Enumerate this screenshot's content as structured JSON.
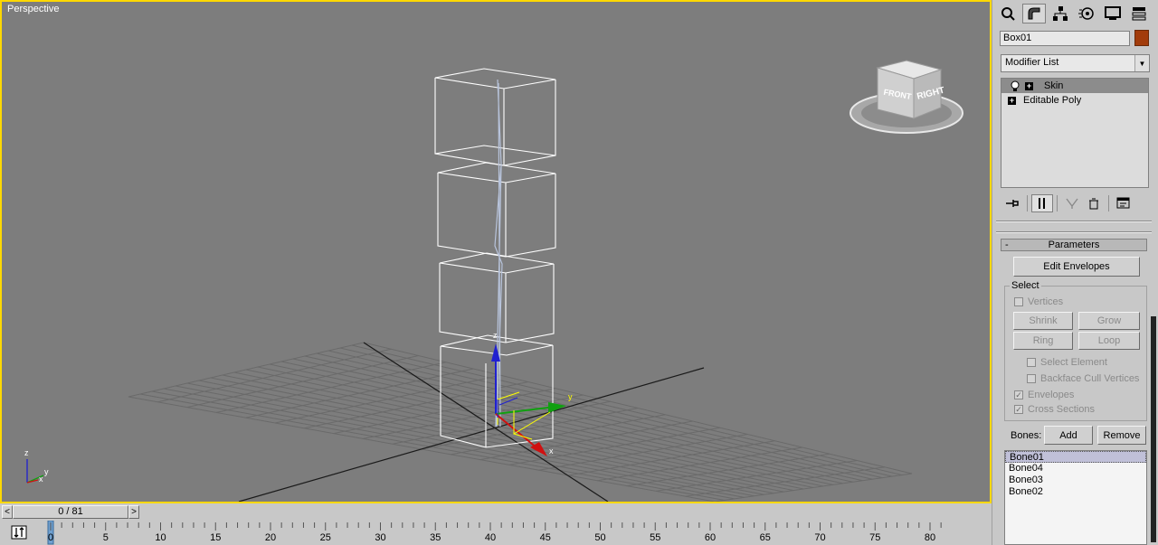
{
  "viewport": {
    "label": "Perspective",
    "viewcube": {
      "front": "FRONT",
      "right": "RIGHT"
    },
    "gizmo_axes": {
      "x": "x",
      "y": "y",
      "z": "z"
    },
    "tripod_axes": {
      "x": "x",
      "y": "y",
      "z": "z"
    }
  },
  "command_panel": {
    "tabs": [
      {
        "name": "create-tab",
        "icon": "create-icon"
      },
      {
        "name": "modify-tab",
        "icon": "modify-icon",
        "active": true
      },
      {
        "name": "hierarchy-tab",
        "icon": "hierarchy-icon"
      },
      {
        "name": "motion-tab",
        "icon": "motion-icon"
      },
      {
        "name": "display-tab",
        "icon": "display-icon"
      },
      {
        "name": "utilities-tab",
        "icon": "utilities-icon"
      }
    ],
    "object_name": "Box01",
    "object_color": "#a23c0b",
    "modifier_list": {
      "placeholder": "Modifier List"
    },
    "stack": [
      {
        "label": "Skin",
        "selected": true
      },
      {
        "label": "Editable Poly",
        "selected": false
      }
    ],
    "stack_tools": [
      "pin-stack-icon",
      "show-end-result-icon",
      "make-unique-icon",
      "remove-modifier-icon",
      "configure-sets-icon"
    ]
  },
  "parameters": {
    "rollout_title": "Parameters",
    "rollout_toggle": "-",
    "edit_envelopes": "Edit Envelopes",
    "select_group": "Select",
    "vertices": "Vertices",
    "shrink": "Shrink",
    "grow": "Grow",
    "ring": "Ring",
    "loop": "Loop",
    "select_element": "Select Element",
    "backface_cull": "Backface Cull Vertices",
    "envelopes": "Envelopes",
    "cross_sections": "Cross Sections",
    "check_mark": "✓",
    "bones_label": "Bones:",
    "add": "Add",
    "remove": "Remove",
    "bones": [
      "Bone01",
      "Bone04",
      "Bone03",
      "Bone02"
    ]
  },
  "timeline": {
    "frame": "0 / 81",
    "prev": "<",
    "next": ">",
    "ticks": [
      "0",
      "5",
      "10",
      "15",
      "20",
      "25",
      "30",
      "35",
      "40",
      "45",
      "50",
      "55",
      "60",
      "65",
      "70",
      "75",
      "80"
    ],
    "current_frame": 0,
    "total_frames": 81
  }
}
